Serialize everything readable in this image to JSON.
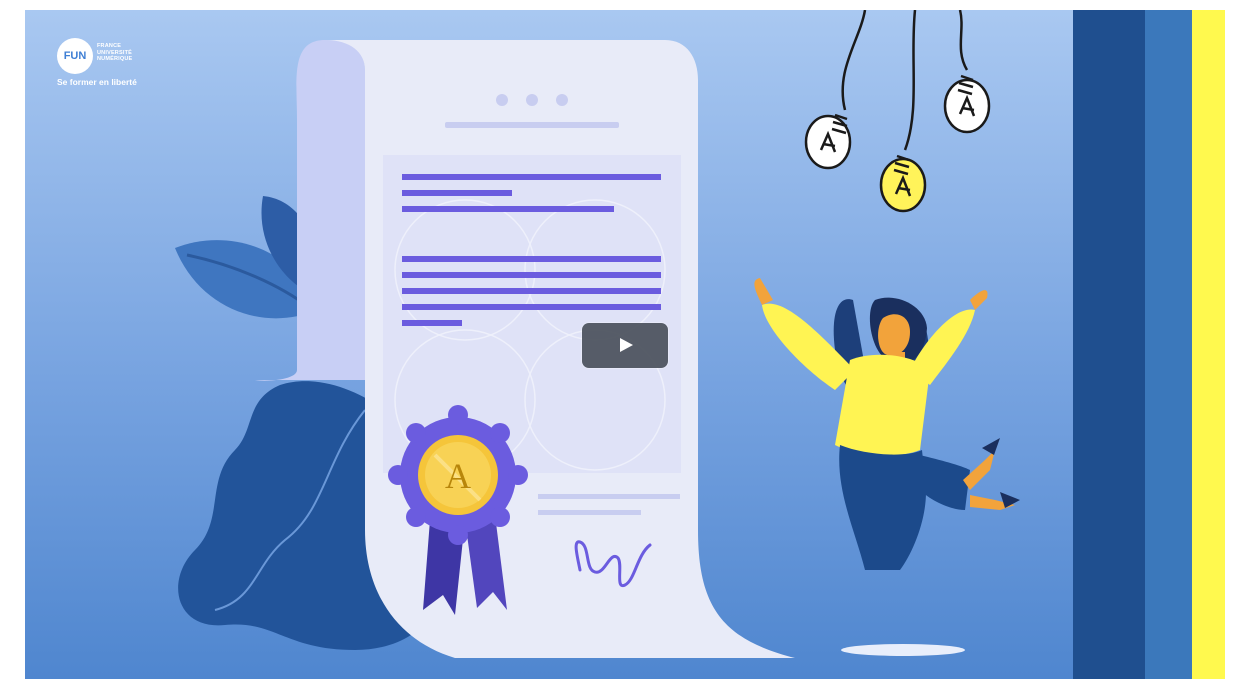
{
  "logo": {
    "badge_text": "FUN",
    "line1": "FRANCE",
    "line2": "UNIVERSITÉ",
    "line3": "NUMÉRIQUE",
    "tagline": "Se former en liberté"
  },
  "certificate": {
    "seal_letter": "A"
  },
  "player": {
    "play_icon": "play-icon"
  },
  "colors": {
    "background_top": "#a9c8f1",
    "background_bottom": "#4f86cf",
    "stripe_dark": "#1f4f8f",
    "stripe_mid": "#3b78bb",
    "stripe_yellow": "#fff94e",
    "text_lines": "#6b5cdf",
    "seal_gold": "#f5c53a",
    "seal_ribbon": "#4a3fb0",
    "person_top": "#fff453",
    "person_pants": "#1c4a8b"
  }
}
